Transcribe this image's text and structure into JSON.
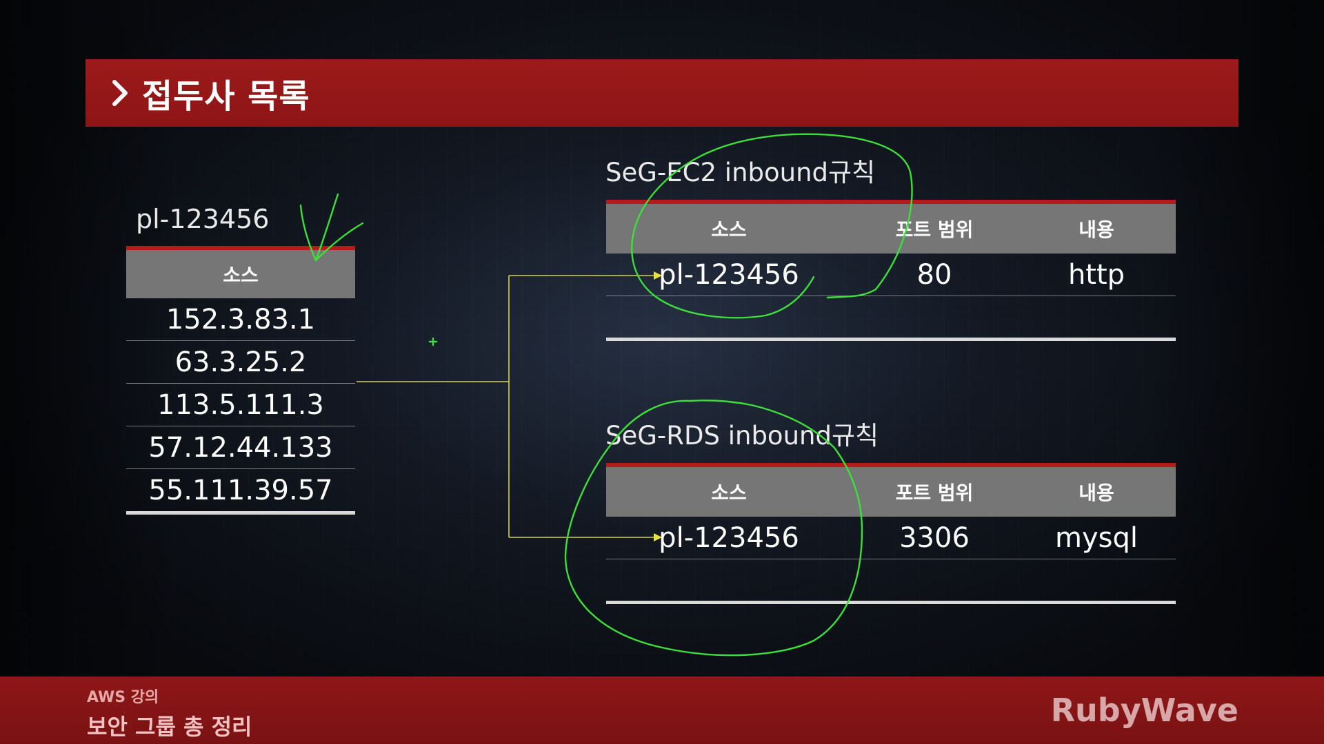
{
  "header": {
    "title": "접두사 목록",
    "chevron_icon": "chevron-right-icon"
  },
  "prefix_list": {
    "label": "pl-123456",
    "column_header": "소스",
    "items": [
      "152.3.83.1",
      "63.3.25.2",
      "113.5.111.3",
      "57.12.44.133",
      "55.111.39.57"
    ]
  },
  "ec2_rules": {
    "title": "SeG-EC2 inbound규칙",
    "columns": [
      "소스",
      "포트 범위",
      "내용"
    ],
    "rows": [
      {
        "source": "pl-123456",
        "port": "80",
        "desc": "http"
      }
    ]
  },
  "rds_rules": {
    "title": "SeG-RDS inbound규칙",
    "columns": [
      "소스",
      "포트 범위",
      "내용"
    ],
    "rows": [
      {
        "source": "pl-123456",
        "port": "3306",
        "desc": "mysql"
      }
    ]
  },
  "footer": {
    "course": "AWS 강의",
    "lecture": "보안 그룹 총 정리",
    "brand": "RubyWave"
  },
  "colors": {
    "accent_red": "#9c1a1b",
    "connector_yellow": "#d4d24a",
    "annotation_green": "#3de03a",
    "table_header_gray": "#767676"
  }
}
